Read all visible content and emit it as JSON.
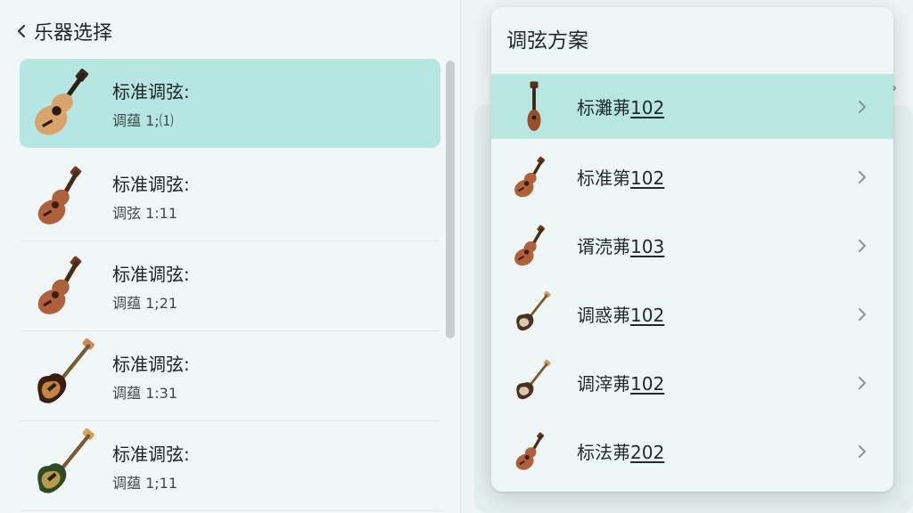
{
  "header": {
    "title": "乐器选择"
  },
  "instruments": [
    {
      "name": "标准调弦:",
      "detail": "调蕴 1;⑴",
      "icon": "acoustic-guitar-icon"
    },
    {
      "name": "标准调弦:",
      "detail": "调弦 1:11",
      "icon": "ukulele-icon"
    },
    {
      "name": "标准调弦:",
      "detail": "调蕴 1;21",
      "icon": "ukulele-icon"
    },
    {
      "name": "标准调弦:",
      "detail": "调蕴 1:31",
      "icon": "electric-bass-sunburst-icon"
    },
    {
      "name": "标准调弦:",
      "detail": "调蕴 1;11",
      "icon": "electric-bass-green-icon"
    }
  ],
  "popover": {
    "title": "调弦方案",
    "items": [
      {
        "prefix": "标灘茀",
        "num": "102",
        "icon": "mandolin-icon"
      },
      {
        "prefix": "标准第",
        "num": "102",
        "icon": "ukulele-icon"
      },
      {
        "prefix": "谞涜茀",
        "num": "103",
        "icon": "ukulele-icon"
      },
      {
        "prefix": "调惑茀",
        "num": "102",
        "icon": "electric-guitar-icon"
      },
      {
        "prefix": "调滓茀",
        "num": "102",
        "icon": "electric-guitar-icon"
      },
      {
        "prefix": "标法茀",
        "num": "202",
        "icon": "ukulele-icon"
      }
    ]
  },
  "colors": {
    "selected": "#b5e6e2",
    "panel": "#f1f6f7",
    "popover": "#eef6f6"
  }
}
